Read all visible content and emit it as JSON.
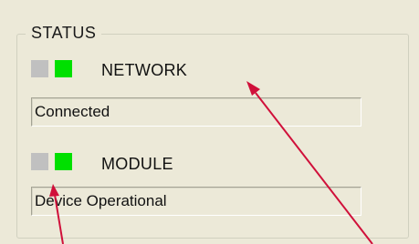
{
  "status_group": {
    "title": "STATUS"
  },
  "network": {
    "label": "NETWORK",
    "value": "Connected",
    "led_left_state": "off",
    "led_right_state": "on"
  },
  "module": {
    "label": "MODULE",
    "value": "Device Operational",
    "led_left_state": "off",
    "led_right_state": "on"
  },
  "colors": {
    "panel_background": "#ece9d8",
    "led_on": "#00e000",
    "led_off": "#c0c0c0",
    "annotation_arrow": "#d0103a"
  }
}
